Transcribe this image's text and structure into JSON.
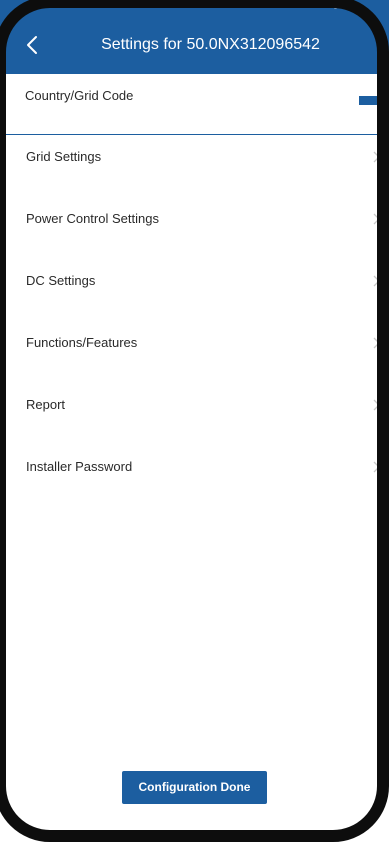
{
  "header": {
    "title": "Settings for 50.0NX312096542",
    "back_icon": "chevron-left-icon"
  },
  "menu": {
    "items": [
      {
        "label": "Country/Grid Code"
      },
      {
        "label": "Grid Settings"
      },
      {
        "label": "Power Control Settings"
      },
      {
        "label": "DC Settings"
      },
      {
        "label": "Functions/Features"
      },
      {
        "label": "Report"
      },
      {
        "label": "Installer Password"
      }
    ],
    "chevron_icon": "chevron-right-icon"
  },
  "footer": {
    "done_label": "Configuration Done"
  },
  "colors": {
    "primary": "#1c5ea0",
    "background": "#ffffff",
    "text": "#2a2a2a",
    "chevron": "#c8c8c8"
  }
}
